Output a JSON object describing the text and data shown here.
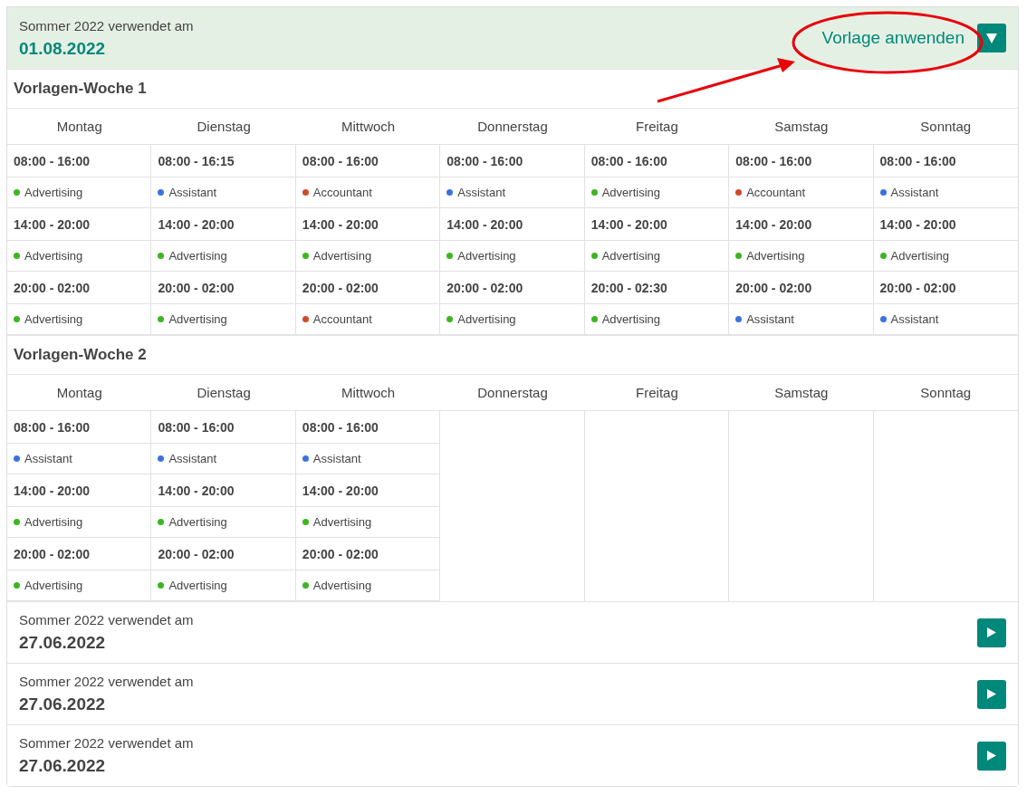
{
  "templates": [
    {
      "label": "Sommer 2022 verwendet am",
      "date": "01.08.2022",
      "expanded": true,
      "action": "Vorlage anwenden",
      "annotated": true,
      "weeks": [
        {
          "title": "Vorlagen-Woche 1",
          "days": [
            {
              "name": "Montag",
              "shifts": [
                {
                  "time": "08:00 - 16:00",
                  "role": "Advertising",
                  "color": "#3cb521"
                },
                {
                  "time": "14:00 - 20:00",
                  "role": "Advertising",
                  "color": "#3cb521"
                },
                {
                  "time": "20:00 - 02:00",
                  "role": "Advertising",
                  "color": "#3cb521"
                }
              ]
            },
            {
              "name": "Dienstag",
              "shifts": [
                {
                  "time": "08:00 - 16:15",
                  "role": "Assistant",
                  "color": "#3a72e0"
                },
                {
                  "time": "14:00 - 20:00",
                  "role": "Advertising",
                  "color": "#3cb521"
                },
                {
                  "time": "20:00 - 02:00",
                  "role": "Advertising",
                  "color": "#3cb521"
                }
              ]
            },
            {
              "name": "Mittwoch",
              "shifts": [
                {
                  "time": "08:00 - 16:00",
                  "role": "Accountant",
                  "color": "#cf4a2c"
                },
                {
                  "time": "14:00 - 20:00",
                  "role": "Advertising",
                  "color": "#3cb521"
                },
                {
                  "time": "20:00 - 02:00",
                  "role": "Accountant",
                  "color": "#cf4a2c"
                }
              ]
            },
            {
              "name": "Donnerstag",
              "shifts": [
                {
                  "time": "08:00 - 16:00",
                  "role": "Assistant",
                  "color": "#3a72e0"
                },
                {
                  "time": "14:00 - 20:00",
                  "role": "Advertising",
                  "color": "#3cb521"
                },
                {
                  "time": "20:00 - 02:00",
                  "role": "Advertising",
                  "color": "#3cb521"
                }
              ]
            },
            {
              "name": "Freitag",
              "shifts": [
                {
                  "time": "08:00 - 16:00",
                  "role": "Advertising",
                  "color": "#3cb521"
                },
                {
                  "time": "14:00 - 20:00",
                  "role": "Advertising",
                  "color": "#3cb521"
                },
                {
                  "time": "20:00 - 02:30",
                  "role": "Advertising",
                  "color": "#3cb521"
                }
              ]
            },
            {
              "name": "Samstag",
              "shifts": [
                {
                  "time": "08:00 - 16:00",
                  "role": "Accountant",
                  "color": "#cf4a2c"
                },
                {
                  "time": "14:00 - 20:00",
                  "role": "Advertising",
                  "color": "#3cb521"
                },
                {
                  "time": "20:00 - 02:00",
                  "role": "Assistant",
                  "color": "#3a72e0"
                }
              ]
            },
            {
              "name": "Sonntag",
              "shifts": [
                {
                  "time": "08:00 - 16:00",
                  "role": "Assistant",
                  "color": "#3a72e0"
                },
                {
                  "time": "14:00 - 20:00",
                  "role": "Advertising",
                  "color": "#3cb521"
                },
                {
                  "time": "20:00 - 02:00",
                  "role": "Assistant",
                  "color": "#3a72e0"
                }
              ]
            }
          ]
        },
        {
          "title": "Vorlagen-Woche 2",
          "days": [
            {
              "name": "Montag",
              "shifts": [
                {
                  "time": "08:00 - 16:00",
                  "role": "Assistant",
                  "color": "#3a72e0"
                },
                {
                  "time": "14:00 - 20:00",
                  "role": "Advertising",
                  "color": "#3cb521"
                },
                {
                  "time": "20:00 - 02:00",
                  "role": "Advertising",
                  "color": "#3cb521"
                }
              ]
            },
            {
              "name": "Dienstag",
              "shifts": [
                {
                  "time": "08:00 - 16:00",
                  "role": "Assistant",
                  "color": "#3a72e0"
                },
                {
                  "time": "14:00 - 20:00",
                  "role": "Advertising",
                  "color": "#3cb521"
                },
                {
                  "time": "20:00 - 02:00",
                  "role": "Advertising",
                  "color": "#3cb521"
                }
              ]
            },
            {
              "name": "Mittwoch",
              "shifts": [
                {
                  "time": "08:00 - 16:00",
                  "role": "Assistant",
                  "color": "#3a72e0"
                },
                {
                  "time": "14:00 - 20:00",
                  "role": "Advertising",
                  "color": "#3cb521"
                },
                {
                  "time": "20:00 - 02:00",
                  "role": "Advertising",
                  "color": "#3cb521"
                }
              ]
            },
            {
              "name": "Donnerstag"
            },
            {
              "name": "Freitag"
            },
            {
              "name": "Samstag"
            },
            {
              "name": "Sonntag"
            }
          ]
        }
      ]
    },
    {
      "label": "Sommer 2022 verwendet am",
      "date": "27.06.2022",
      "expanded": false
    },
    {
      "label": "Sommer 2022 verwendet am",
      "date": "27.06.2022",
      "expanded": false
    },
    {
      "label": "Sommer 2022 verwendet am",
      "date": "27.06.2022",
      "expanded": false
    }
  ]
}
